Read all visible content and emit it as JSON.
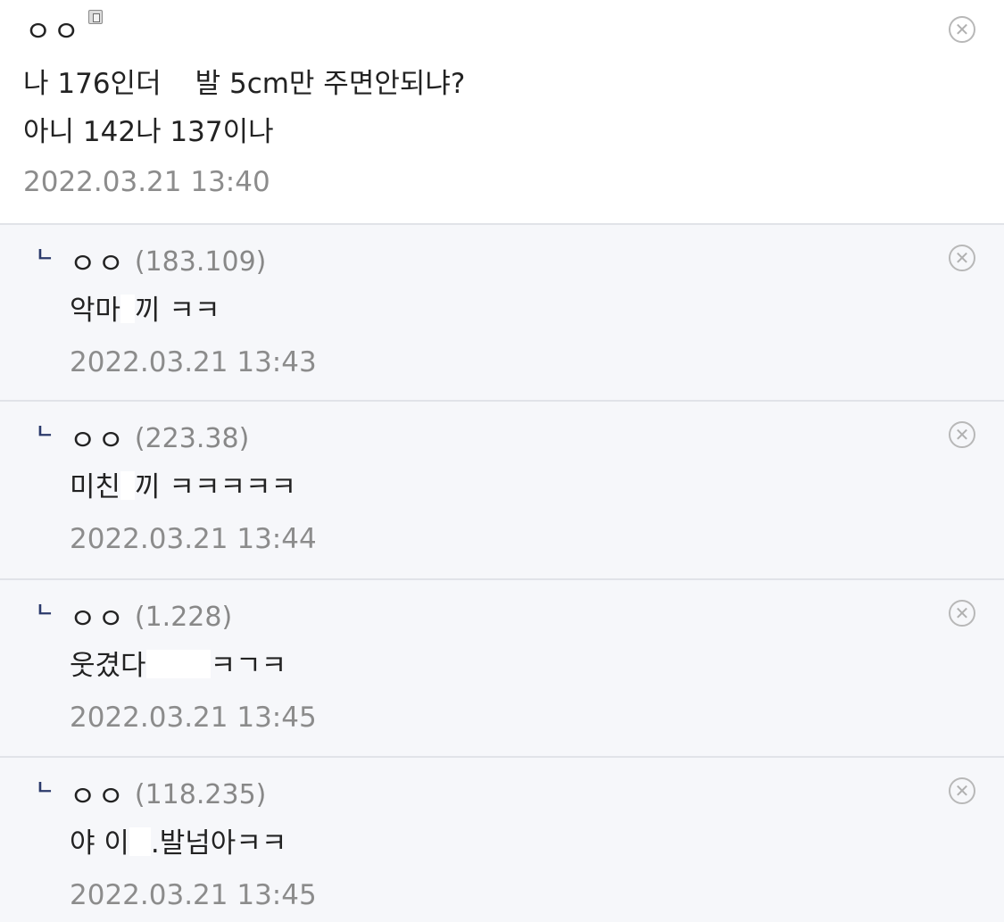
{
  "comments": {
    "main": {
      "nickname": "ㅇㅇ",
      "line1_a": "나 176인더",
      "line1_b": "발 5cm만 주면안되냐?",
      "line2": "아니 142나 137이나",
      "date": "2022.03.21 13:40",
      "delete_icon": "close-circle-icon",
      "mobile_icon": "mobile-icon"
    },
    "replies": [
      {
        "reply_mark": "ㄴ",
        "nickname": "ㅇㅇ",
        "ip": "(183.109)",
        "text_a": "악마",
        "text_b": "끼 ㅋㅋ",
        "date": "2022.03.21 13:43"
      },
      {
        "reply_mark": "ㄴ",
        "nickname": "ㅇㅇ",
        "ip": "(223.38)",
        "text_a": "미친",
        "text_b": "끼 ㅋㅋㅋㅋㅋ",
        "date": "2022.03.21 13:44"
      },
      {
        "reply_mark": "ㄴ",
        "nickname": "ㅇㅇ",
        "ip": "(1.228)",
        "text_a": "웃겼다",
        "text_b": "ㅋㄱㅋ",
        "date": "2022.03.21 13:45"
      },
      {
        "reply_mark": "ㄴ",
        "nickname": "ㅇㅇ",
        "ip": "(118.235)",
        "text_a": "야 이",
        "text_b": ".발넘아ㅋㅋ",
        "date": "2022.03.21 13:45"
      }
    ]
  },
  "colors": {
    "reply_background": "#f6f7fa",
    "divider": "#e1e3e8",
    "reply_mark": "#2b3a6b",
    "meta_gray": "#8c8c8c"
  }
}
